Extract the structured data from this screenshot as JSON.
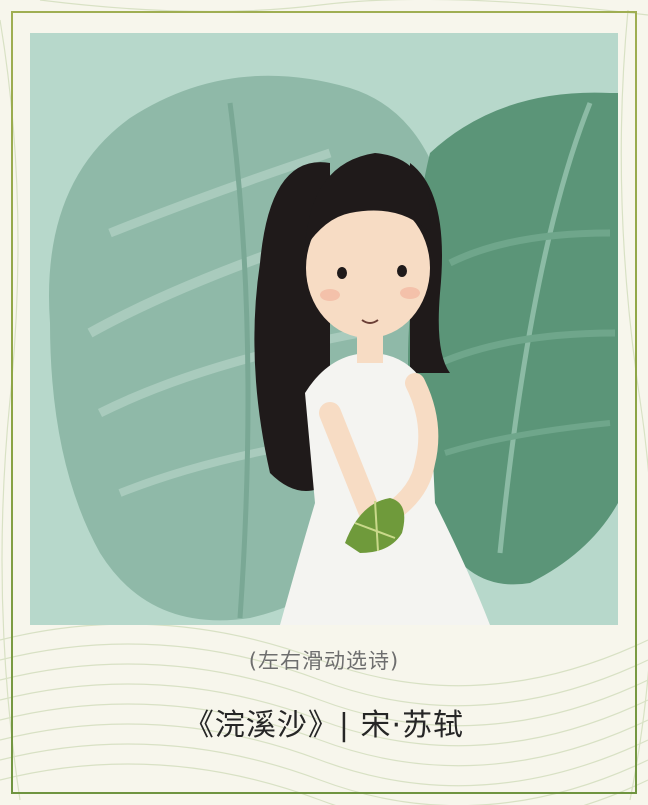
{
  "hint_text": "(左右滑动选诗)",
  "poem_title": "《浣溪沙》",
  "separator": "|",
  "poet": "宋·苏轼",
  "colors": {
    "frame": "#8da545",
    "illustration_bg": "#b7d8cb",
    "leaf_dark": "#4f8a6d",
    "leaf_light": "#8fb9a8",
    "dress": "#f4f4f1",
    "hair": "#1f1a1a",
    "zongzi": "#6f9a3b"
  },
  "icons": [
    "girl-illustration",
    "zongzi-icon",
    "leaf-pattern"
  ]
}
